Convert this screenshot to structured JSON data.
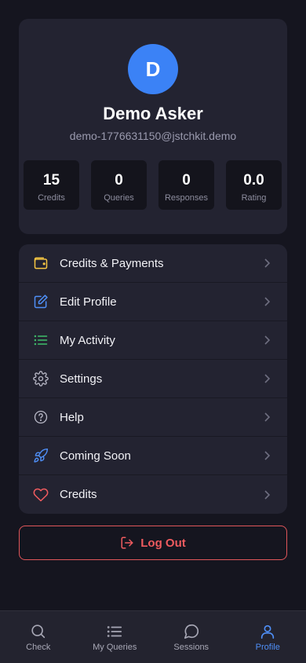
{
  "profile": {
    "avatar_letter": "D",
    "name": "Demo Asker",
    "email": "demo-1776631150@jstchkit.demo",
    "stats": [
      {
        "value": "15",
        "label": "Credits"
      },
      {
        "value": "0",
        "label": "Queries"
      },
      {
        "value": "0",
        "label": "Responses"
      },
      {
        "value": "0.0",
        "label": "Rating"
      }
    ]
  },
  "menu": {
    "items": [
      {
        "label": "Credits & Payments",
        "icon": "wallet-icon",
        "color": "#f5c542"
      },
      {
        "label": "Edit Profile",
        "icon": "edit-icon",
        "color": "#4f8ff7"
      },
      {
        "label": "My Activity",
        "icon": "list-icon",
        "color": "#3fbf6b"
      },
      {
        "label": "Settings",
        "icon": "gear-icon",
        "color": "#b8b8c6"
      },
      {
        "label": "Help",
        "icon": "help-icon",
        "color": "#b8b8c6"
      },
      {
        "label": "Coming Soon",
        "icon": "rocket-icon",
        "color": "#4f8ff7"
      },
      {
        "label": "Credits",
        "icon": "heart-icon",
        "color": "#ef5b5f"
      }
    ]
  },
  "logout": {
    "label": "Log Out",
    "color": "#ef5b5f"
  },
  "tabbar": {
    "tabs": [
      {
        "label": "Check",
        "icon": "search-icon"
      },
      {
        "label": "My Queries",
        "icon": "list-icon"
      },
      {
        "label": "Sessions",
        "icon": "chat-icon"
      },
      {
        "label": "Profile",
        "icon": "user-icon",
        "active": true
      }
    ]
  },
  "colors": {
    "accent": "#4f8ff7",
    "background": "#15151f",
    "card": "#232331",
    "danger": "#ef5b5f"
  }
}
